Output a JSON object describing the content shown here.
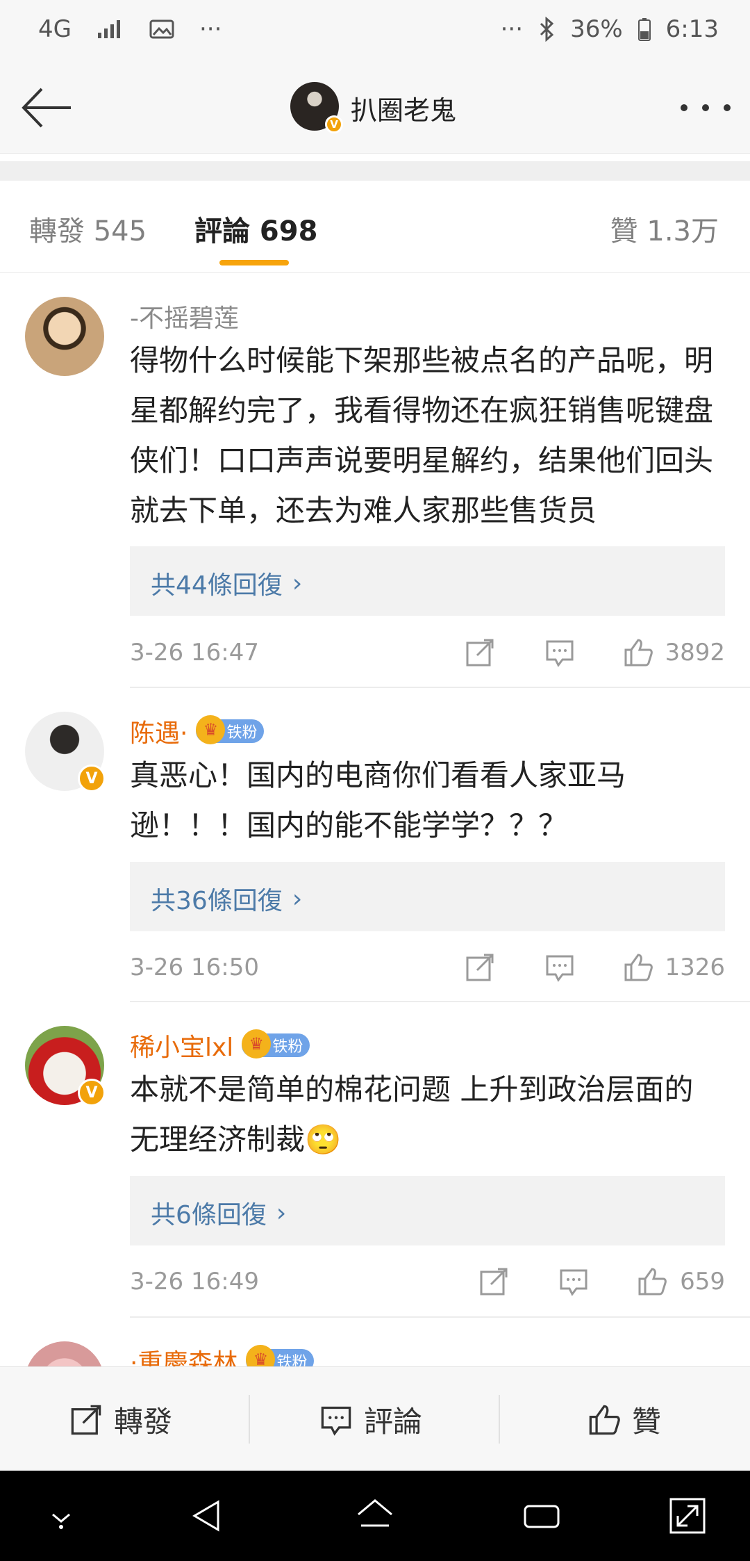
{
  "status_bar": {
    "network": "4G",
    "dots_left": "···",
    "dots_right": "···",
    "battery": "36%",
    "time": "6:13"
  },
  "header": {
    "title": "扒圈老鬼",
    "verified_mark": "V"
  },
  "tabs": {
    "repost": "轉發 545",
    "comments": "評論 698",
    "likes": "贊 1.3万"
  },
  "comments": [
    {
      "username": "-不摇碧莲",
      "fan_badge": "",
      "text": "得物什么时候能下架那些被点名的产品呢，明星都解约完了，我看得物还在疯狂销售呢键盘侠们！口口声声说要明星解约，结果他们回头就去下单，还去为难人家那些售货员",
      "replies": "共44條回復",
      "time": "3-26 16:47",
      "likes": "3892"
    },
    {
      "username": "陈遇·",
      "fan_badge": "铁粉",
      "text": "真恶心！国内的电商你们看看人家亚马逊！！！国内的能不能学学？？？",
      "replies": "共36條回復",
      "time": "3-26 16:50",
      "likes": "1326"
    },
    {
      "username": "稀小宝lxl",
      "fan_badge": "铁粉",
      "text": "本就不是简单的棉花问题 上升到政治层面的无理经济制裁🙄",
      "replies": "共6條回復",
      "time": "3-26 16:49",
      "likes": "659"
    },
    {
      "username": "·重慶森林",
      "fan_badge": "铁粉"
    }
  ],
  "bottom_bar": {
    "repost": "轉發",
    "comment": "評論",
    "like": "贊"
  },
  "colors": {
    "accent": "#f7a40c",
    "username": "#e86b0a",
    "link": "#4c7aa8",
    "badge": "#6fa3e8"
  }
}
